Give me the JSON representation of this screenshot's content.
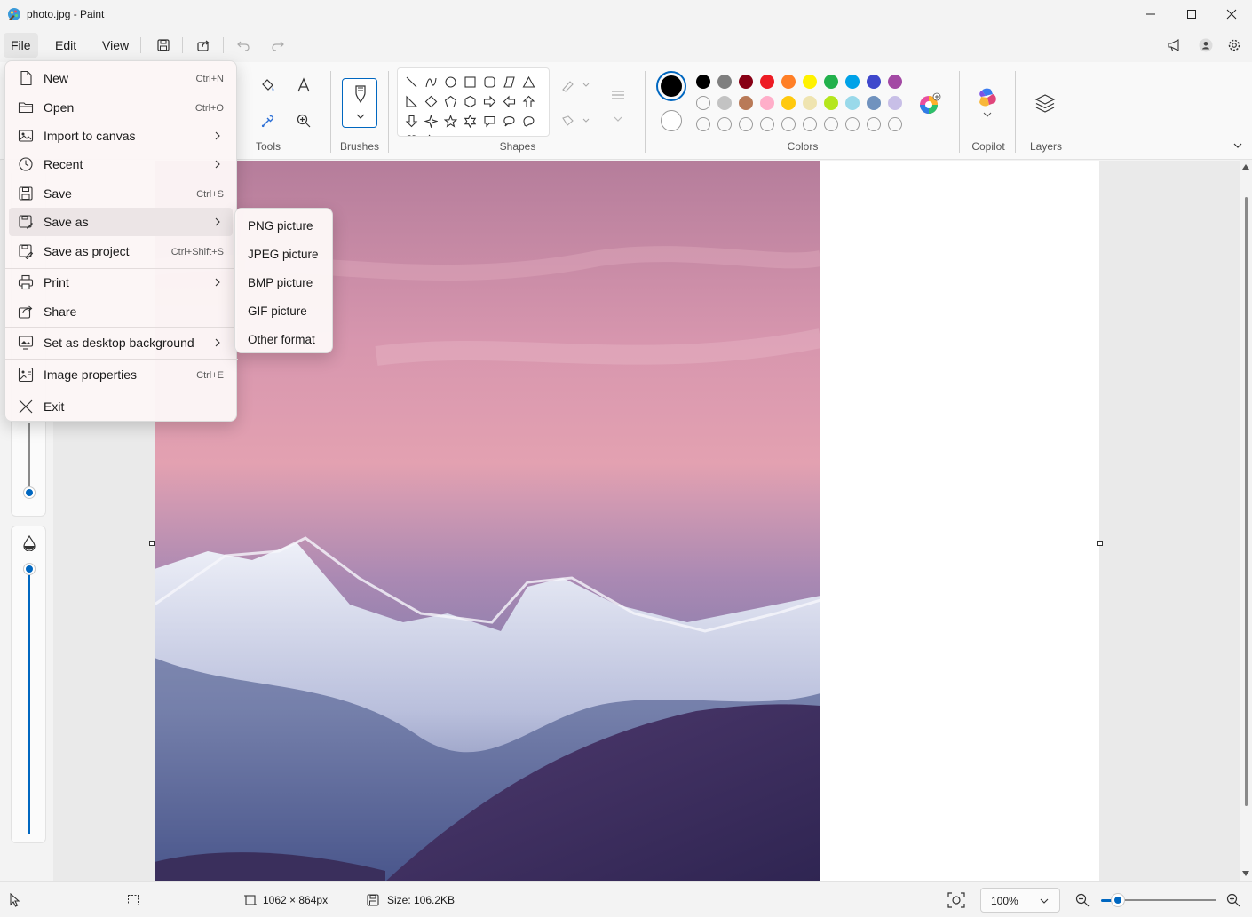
{
  "window": {
    "title": "photo.jpg - Paint"
  },
  "menubar": {
    "file": "File",
    "edit": "Edit",
    "view": "View"
  },
  "ribbon": {
    "groups": {
      "tools": "Tools",
      "brushes": "Brushes",
      "shapes": "Shapes",
      "colors": "Colors",
      "copilot": "Copilot",
      "layers": "Layers"
    },
    "palette": {
      "row1": [
        "#000000",
        "#7f7f7f",
        "#880015",
        "#ed1c24",
        "#ff7f27",
        "#fff200",
        "#22b14c",
        "#00a2e8",
        "#3f48cc",
        "#a349a4"
      ],
      "row2": [
        "",
        "#c3c3c3",
        "#b97a57",
        "#ffaec9",
        "#ffc90e",
        "#efe4b0",
        "#b5e61d",
        "#99d9ea",
        "#7092be",
        "#c8bfe7"
      ],
      "primary_color": "#000000",
      "secondary_color": "#ffffff"
    }
  },
  "file_menu": {
    "items": [
      {
        "label": "New",
        "shortcut": "Ctrl+N",
        "icon": "new-file-icon"
      },
      {
        "label": "Open",
        "shortcut": "Ctrl+O",
        "icon": "folder-icon"
      },
      {
        "label": "Import to canvas",
        "shortcut": "",
        "icon": "import-icon",
        "submenu": true
      },
      {
        "label": "Recent",
        "shortcut": "",
        "icon": "clock-icon",
        "submenu": true
      },
      {
        "label": "Save",
        "shortcut": "Ctrl+S",
        "icon": "save-icon"
      },
      {
        "label": "Save as",
        "shortcut": "",
        "icon": "save-as-icon",
        "submenu": true
      },
      {
        "label": "Save as project",
        "shortcut": "Ctrl+Shift+S",
        "icon": "save-project-icon"
      },
      {
        "label": "Print",
        "shortcut": "",
        "icon": "printer-icon",
        "submenu": true
      },
      {
        "label": "Share",
        "shortcut": "",
        "icon": "share-icon"
      },
      {
        "label": "Set as desktop background",
        "shortcut": "",
        "icon": "desktop-icon",
        "submenu": true
      },
      {
        "label": "Image properties",
        "shortcut": "Ctrl+E",
        "icon": "image-properties-icon"
      },
      {
        "label": "Exit",
        "shortcut": "",
        "icon": "close-icon"
      }
    ]
  },
  "save_as_submenu": {
    "items": [
      "PNG picture",
      "JPEG picture",
      "BMP picture",
      "GIF picture",
      "Other format"
    ]
  },
  "statusbar": {
    "canvas_size": "1062 × 864px",
    "file_size": "Size: 106.2KB",
    "zoom": "100%"
  }
}
